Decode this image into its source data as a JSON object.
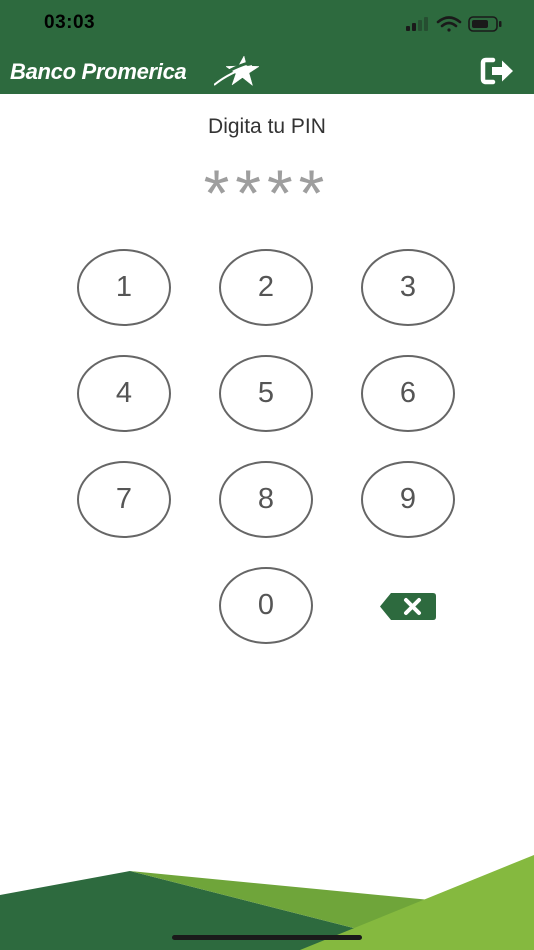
{
  "status_bar": {
    "time": "03:03",
    "icons": [
      "cellular-signal-icon",
      "wifi-icon",
      "battery-icon"
    ]
  },
  "header": {
    "brand_name": "Banco Promerica",
    "logo_icon": "star-logo-icon",
    "logout_icon": "logout-icon"
  },
  "pin": {
    "title": "Digita tu PIN",
    "mask": "****"
  },
  "keypad": {
    "keys": [
      "1",
      "2",
      "3",
      "4",
      "5",
      "6",
      "7",
      "8",
      "9",
      "0"
    ],
    "delete_icon": "backspace-icon"
  },
  "colors": {
    "brand_green": "#2d6a3e",
    "light_green": "#85b93f",
    "key_border": "#666666",
    "mask_gray": "#9e9e9e"
  }
}
